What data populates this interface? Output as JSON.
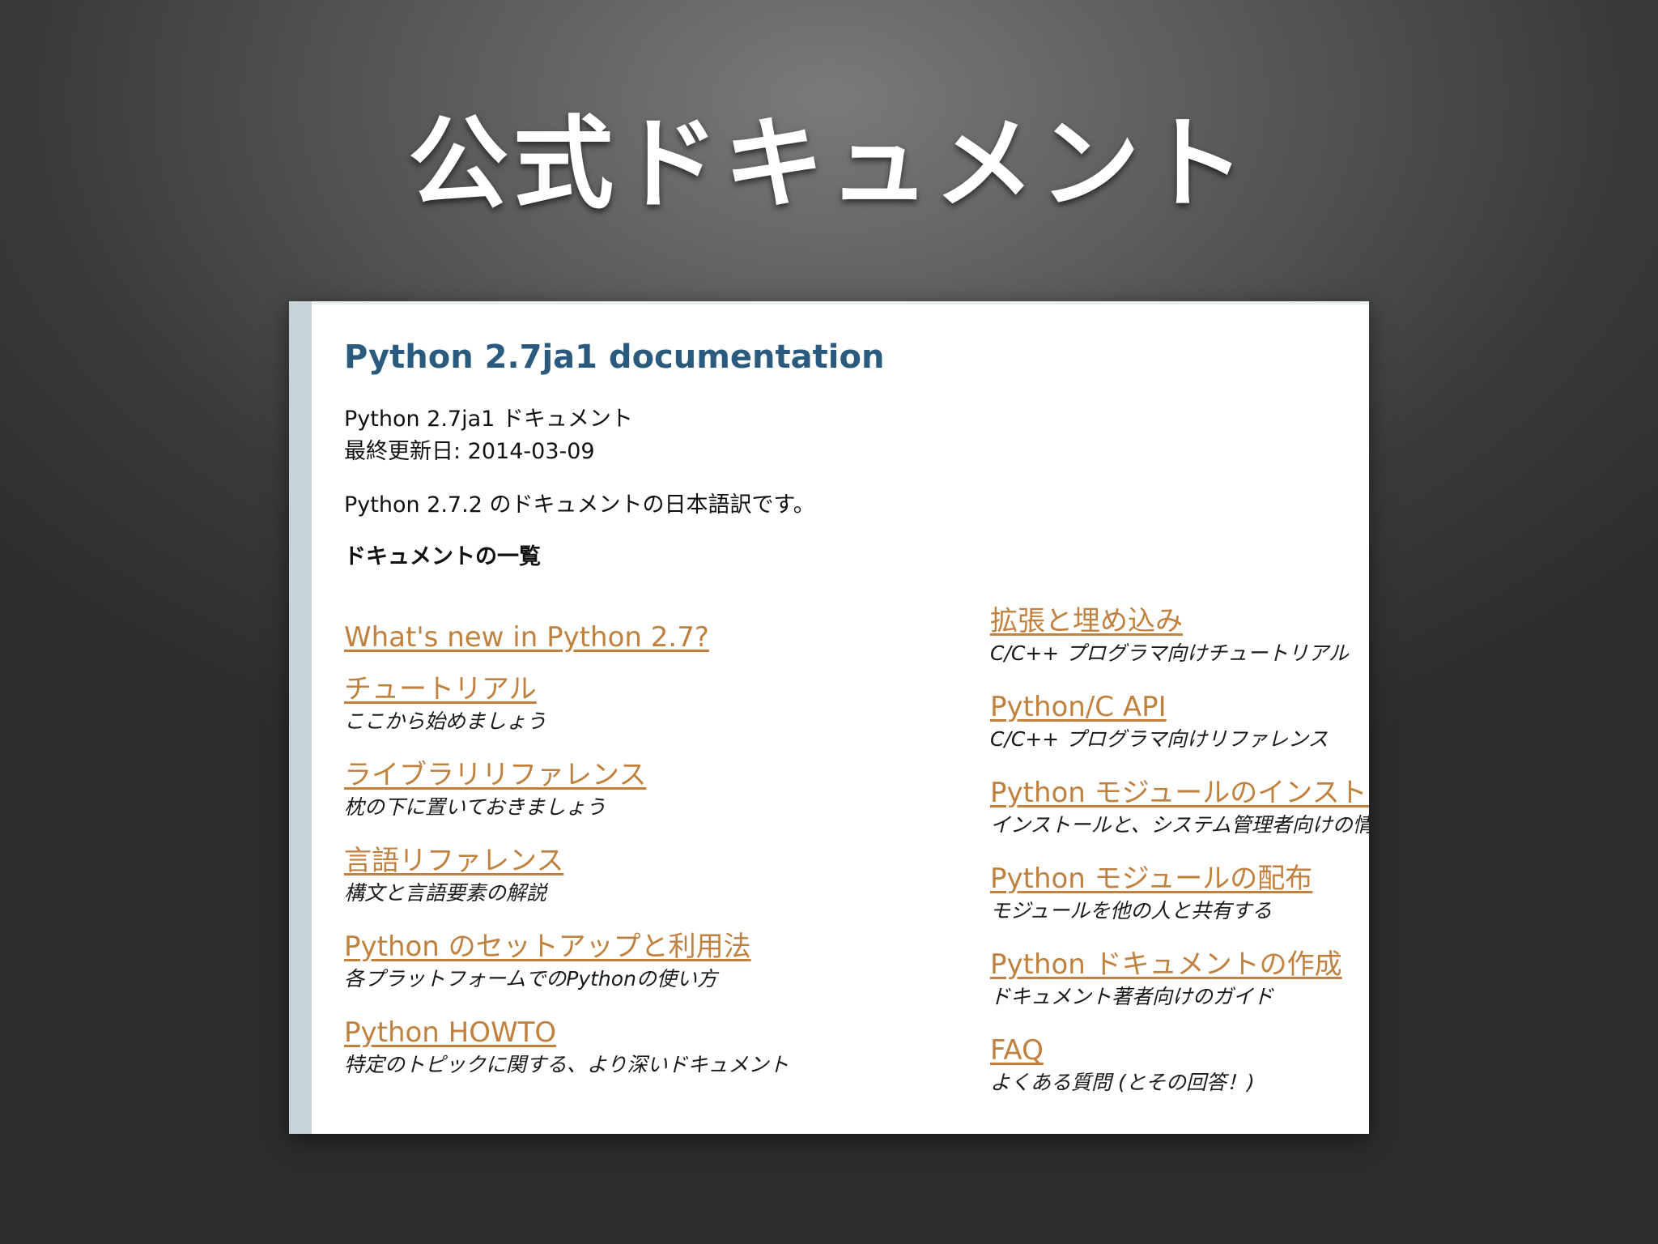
{
  "slide": {
    "title": "公式ドキュメント"
  },
  "doc": {
    "title": "Python 2.7ja1 documentation",
    "subtitle": "Python 2.7ja1 ドキュメント",
    "updated": "最終更新日: 2014-03-09",
    "intro": "Python 2.7.2 のドキュメントの日本語訳です。",
    "list_heading": "ドキュメントの一覧",
    "left_entries": [
      {
        "link": "What's new in Python 2.7?",
        "desc": ""
      },
      {
        "link": "チュートリアル",
        "desc": "ここから始めましょう"
      },
      {
        "link": "ライブラリリファレンス",
        "desc": "枕の下に置いておきましょう"
      },
      {
        "link": "言語リファレンス",
        "desc": "構文と言語要素の解説"
      },
      {
        "link": "Python のセットアップと利用法",
        "desc": "各プラットフォームでのPythonの使い方"
      },
      {
        "link": "Python HOWTO",
        "desc": "特定のトピックに関する、より深いドキュメント"
      }
    ],
    "right_entries": [
      {
        "link": "拡張と埋め込み",
        "desc": "C/C++ プログラマ向けチュートリアル"
      },
      {
        "link": "Python/C API",
        "desc": "C/C++ プログラマ向けリファレンス"
      },
      {
        "link": "Python モジュールのインストール",
        "desc": "インストールと、システム管理者向けの情報"
      },
      {
        "link": "Python モジュールの配布",
        "desc": "モジュールを他の人と共有する"
      },
      {
        "link": "Python ドキュメントの作成",
        "desc": "ドキュメント著者向けのガイド"
      },
      {
        "link": "FAQ",
        "desc": "よくある質問 (とその回答！)"
      }
    ]
  },
  "colors": {
    "title_blue": "#2a5a7e",
    "link_orange": "#c0813f",
    "sidebar_bar": "#c6d4da"
  }
}
